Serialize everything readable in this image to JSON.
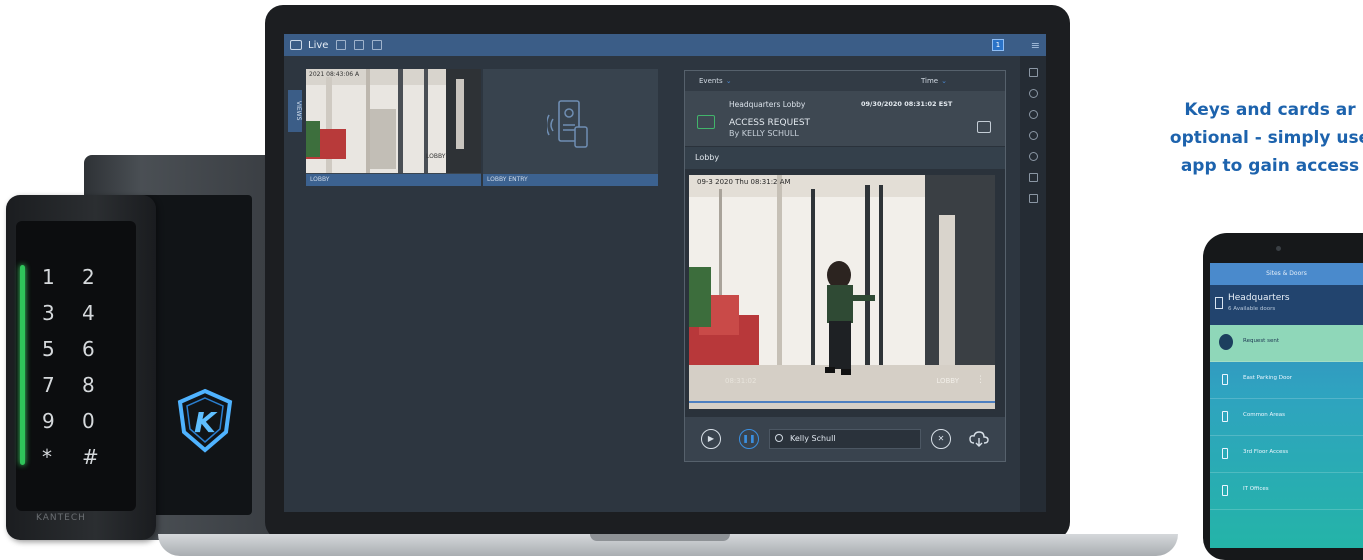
{
  "promo": {
    "line1": "Keys and cards ar",
    "line2": "optional - simply use",
    "line3": "app to gain access"
  },
  "keypad": {
    "keys": [
      "1",
      "2",
      "3",
      "4",
      "5",
      "6",
      "7",
      "8",
      "9",
      "0",
      "*",
      "#"
    ],
    "brand": "KANTECH",
    "led_color": "#2fc45a"
  },
  "app": {
    "topbar": {
      "title": "Live",
      "notification_count": "1"
    },
    "views_tab": "VIEWS",
    "tiles": [
      {
        "caption": "LOBBY",
        "osd": "2021 08:43:06 A",
        "overlay": "LOBBY"
      },
      {
        "caption": "LOBBY ENTRY"
      }
    ],
    "events": {
      "col_events": "Events",
      "col_time": "Time",
      "item": {
        "location": "Headquarters Lobby",
        "timestamp": "09/30/2020 08:31:02 EST",
        "title": "ACCESS REQUEST",
        "who": "By KELLY SCHULL"
      },
      "camera_label": "Lobby",
      "video": {
        "osd_top": "09-3 2020 Thu 08:31:2 AM",
        "osd_time": "08:31:02",
        "osd_label": "LOBBY"
      },
      "search_value": "Kelly Schull"
    },
    "accent": "#3b5d87"
  },
  "phone": {
    "header": "Sites & Doors",
    "site_name": "Headquarters",
    "site_sub": "6 Available doors",
    "doors": [
      {
        "label": "Request sent",
        "state": "sent"
      },
      {
        "label": "East Parking Door"
      },
      {
        "label": "Common Areas"
      },
      {
        "label": "3rd Floor Access"
      },
      {
        "label": "IT Offices"
      }
    ]
  }
}
